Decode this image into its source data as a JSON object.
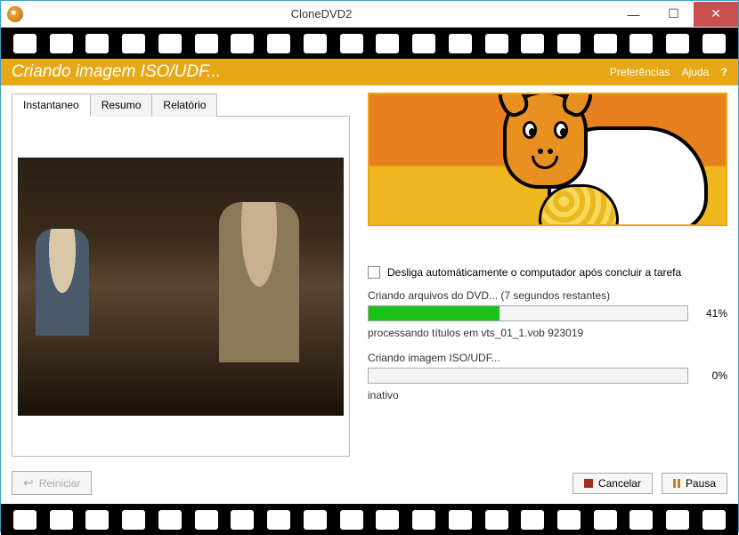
{
  "window": {
    "title": "CloneDVD2"
  },
  "banner": {
    "title": "Criando imagem ISO/UDF...",
    "prefs": "Preferências",
    "help": "Ajuda"
  },
  "tabs": {
    "snapshot": "Instantaneo",
    "summary": "Resumo",
    "report": "Relatório"
  },
  "shutdown_checkbox": "Desliga automáticamente o computador após concluir a tarefa",
  "progress1": {
    "label": "Criando arquivos do DVD... (7 segundos restantes)",
    "percent_text": "41%",
    "percent": 41,
    "status": "processando títulos em vts_01_1.vob 923019"
  },
  "progress2": {
    "label": "Criando imagem ISO/UDF...",
    "percent_text": "0%",
    "percent": 0,
    "status": "inativo"
  },
  "buttons": {
    "restart": "Reiniciar",
    "cancel": "Cancelar",
    "pause": "Pausa"
  }
}
